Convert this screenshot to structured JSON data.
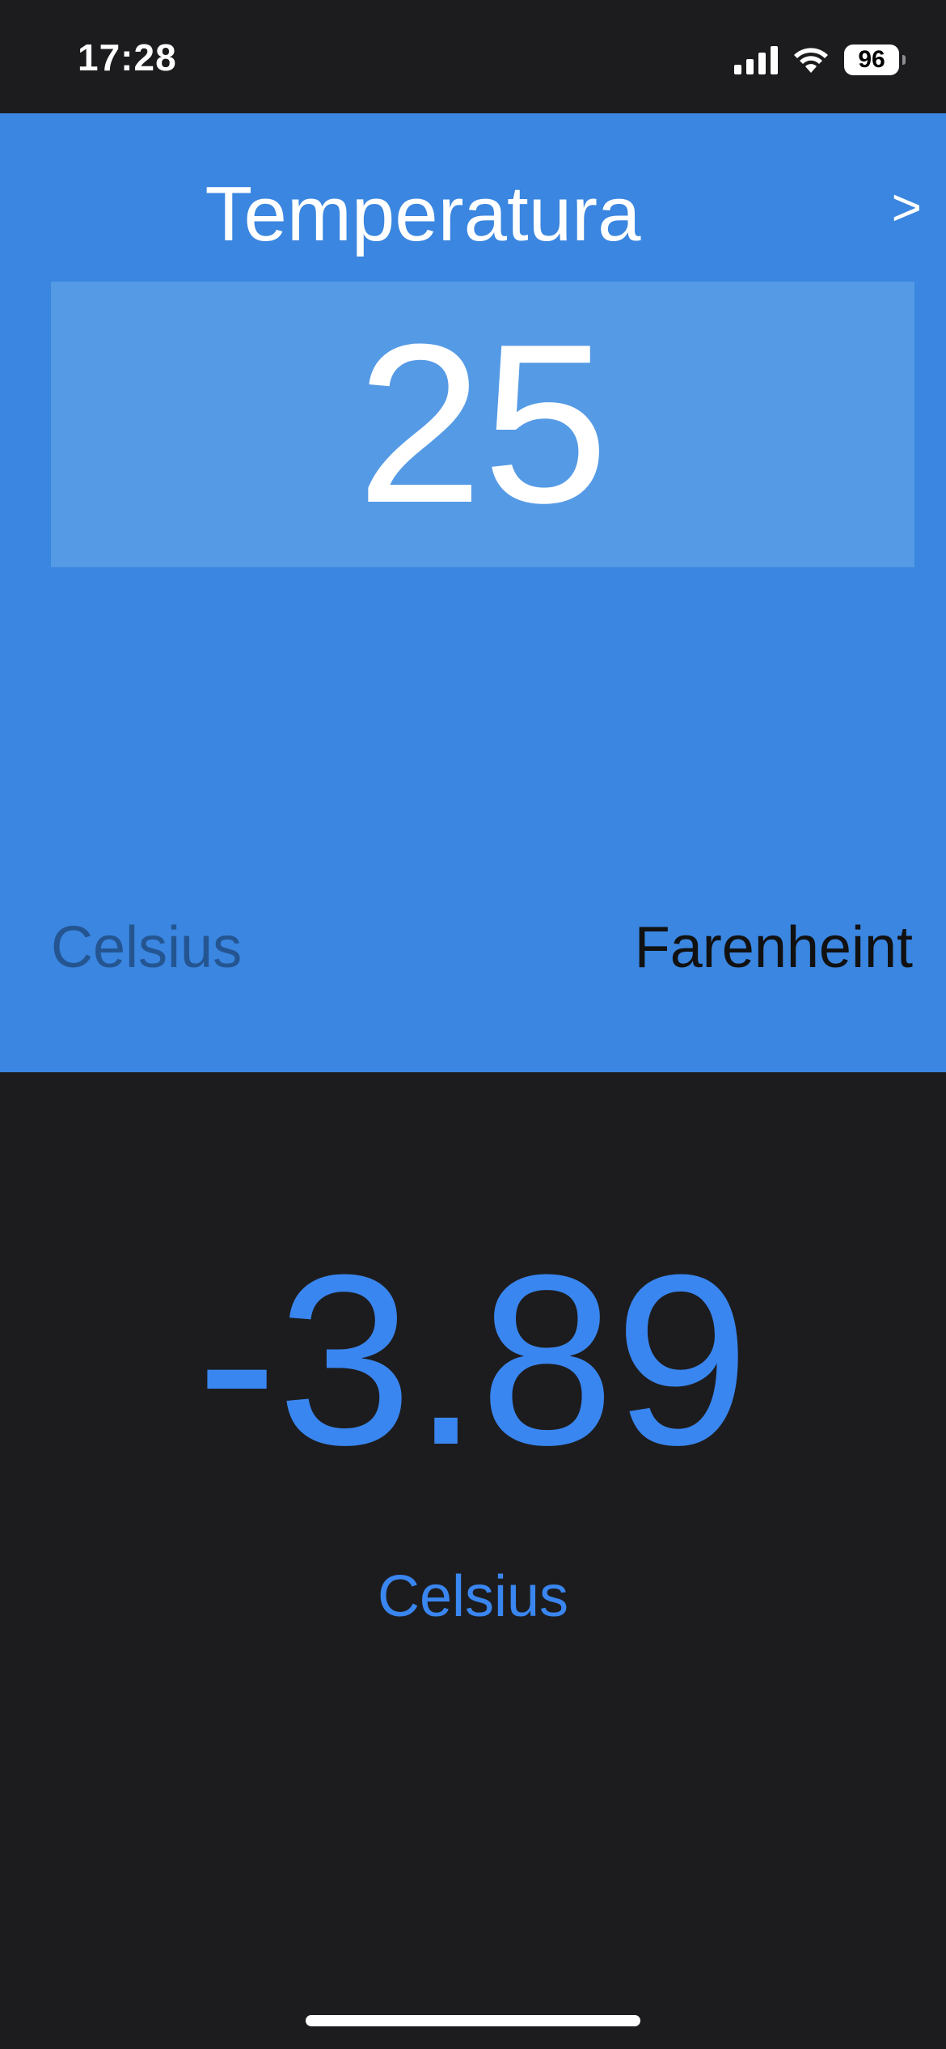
{
  "status_bar": {
    "time": "17:28",
    "battery": "96",
    "signal_icon": "cellular-signal-icon",
    "wifi_icon": "wifi-icon",
    "battery_icon": "battery-icon"
  },
  "converter": {
    "title": "Temperatura",
    "next_label": ">",
    "input_value": "25",
    "units": {
      "from": "Celsius",
      "to": "Farenheint"
    },
    "result_value": "-3.89",
    "result_unit": "Celsius"
  },
  "colors": {
    "panel_blue": "#3a86e0",
    "input_box": "#559ae5",
    "result_blue": "#3a86f0",
    "background": "#1c1c1e"
  }
}
